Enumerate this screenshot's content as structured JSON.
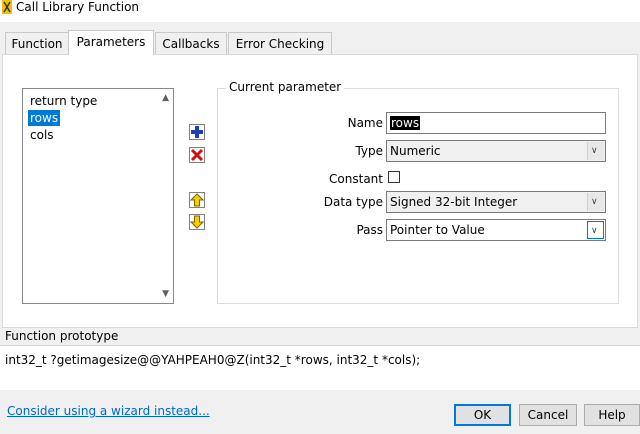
{
  "window": {
    "title": "Call Library Function"
  },
  "tabs": [
    {
      "label": "Function"
    },
    {
      "label": "Parameters"
    },
    {
      "label": "Callbacks"
    },
    {
      "label": "Error Checking"
    }
  ],
  "parameters_list": {
    "items": [
      "return type",
      "rows",
      "cols"
    ],
    "selected": "rows"
  },
  "current_parameter": {
    "group_label": "Current parameter",
    "name_label": "Name",
    "name_value": "rows",
    "type_label": "Type",
    "type_value": "Numeric",
    "constant_label": "Constant",
    "constant_checked": false,
    "data_type_label": "Data type",
    "data_type_value": "Signed 32-bit Integer",
    "pass_label": "Pass",
    "pass_value": "Pointer to Value"
  },
  "prototype": {
    "header": "Function prototype",
    "text": "int32_t ?getimagesize@@YAHPEAH0@Z(int32_t *rows, int32_t *cols);"
  },
  "footer": {
    "wizard_link": "Consider using a wizard instead...",
    "ok_label": "OK",
    "cancel_label": "Cancel",
    "help_label": "Help"
  },
  "icons": {
    "add": "plus-icon",
    "delete": "x-icon",
    "move_up": "arrow-up-icon",
    "move_down": "arrow-down-icon",
    "colors": {
      "add": "#1a3fb8",
      "delete": "#d01010",
      "arrows": "#c8a000"
    }
  }
}
